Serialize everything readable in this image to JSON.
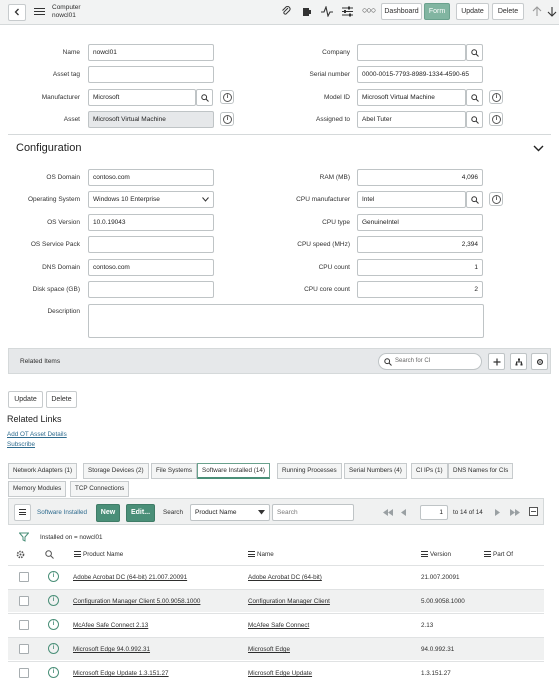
{
  "header": {
    "record_type": "Computer",
    "record_name": "nowcl01",
    "buttons": {
      "dashboard": "Dashboard",
      "form": "Form",
      "update": "Update",
      "delete": "Delete"
    }
  },
  "fields_left": [
    {
      "label": "Name",
      "value": "nowcl01"
    },
    {
      "label": "Asset tag",
      "value": ""
    },
    {
      "label": "Manufacturer",
      "value": "Microsoft"
    },
    {
      "label": "Asset",
      "value": "Microsoft Virtual Machine"
    }
  ],
  "fields_right": [
    {
      "label": "Company",
      "value": ""
    },
    {
      "label": "Serial number",
      "value": "0000-0015-7793-8989-1334-4590-65"
    },
    {
      "label": "Model ID",
      "value": "Microsoft Virtual Machine"
    },
    {
      "label": "Assigned to",
      "value": "Abel Tuter"
    }
  ],
  "configuration": {
    "title": "Configuration",
    "left": [
      {
        "label": "OS Domain",
        "value": "contoso.com"
      },
      {
        "label": "Operating System",
        "value": "Windows 10 Enterprise"
      },
      {
        "label": "OS Version",
        "value": "10.0.19043"
      },
      {
        "label": "OS Service Pack",
        "value": ""
      },
      {
        "label": "DNS Domain",
        "value": "contoso.com"
      },
      {
        "label": "Disk space (GB)",
        "value": ""
      },
      {
        "label": "Description",
        "value": ""
      }
    ],
    "right": [
      {
        "label": "RAM (MB)",
        "value": "4,096"
      },
      {
        "label": "CPU manufacturer",
        "value": "Intel"
      },
      {
        "label": "CPU type",
        "value": "GenuineIntel"
      },
      {
        "label": "CPU speed (MHz)",
        "value": "2,394"
      },
      {
        "label": "CPU count",
        "value": "1"
      },
      {
        "label": "CPU core count",
        "value": "2"
      }
    ]
  },
  "related_items": {
    "title": "Related Items",
    "search_placeholder": "Search for CI"
  },
  "bottom_buttons": {
    "update": "Update",
    "delete": "Delete"
  },
  "related_links": {
    "title": "Related Links",
    "links": [
      "Add OT Asset Details",
      "Subscribe"
    ]
  },
  "tabs": [
    "Network Adapters (1)",
    "Storage Devices (2)",
    "File Systems",
    "Software Installed (14)",
    "Running Processes",
    "Serial Numbers (4)",
    "CI IPs (1)",
    "DNS Names for CIs",
    "Memory Modules",
    "TCP Connections"
  ],
  "list": {
    "title": "Software Installed",
    "new_label": "New",
    "edit_label": "Edit...",
    "search_label": "Search",
    "search_field": "Product Name",
    "search_placeholder": "Search",
    "page_current": "1",
    "page_total": "to 14 of 14",
    "filter_text": "Installed on = nowcl01",
    "columns": [
      "Product Name",
      "Name",
      "Version",
      "Part Of"
    ],
    "rows": [
      {
        "product": "Adobe Acrobat DC (64-bit) 21.007.20091",
        "name": "Adobe Acrobat DC (64-bit)",
        "version": "21.007.20091"
      },
      {
        "product": "Configuration Manager Client 5.00.9058.1000",
        "name": "Configuration Manager Client",
        "version": "5.00.9058.1000"
      },
      {
        "product": "McAfee Safe Connect 2.13",
        "name": "McAfee Safe Connect",
        "version": "2.13"
      },
      {
        "product": "Microsoft Edge 94.0.992.31",
        "name": "Microsoft Edge",
        "version": "94.0.992.31"
      },
      {
        "product": "Microsoft Edge Update 1.3.151.27",
        "name": "Microsoft Edge Update",
        "version": "1.3.151.27"
      }
    ]
  },
  "colors": {
    "accent": "#4a8f78",
    "form_button": "#81b5a1",
    "header_bg": "#f2f3f3"
  }
}
